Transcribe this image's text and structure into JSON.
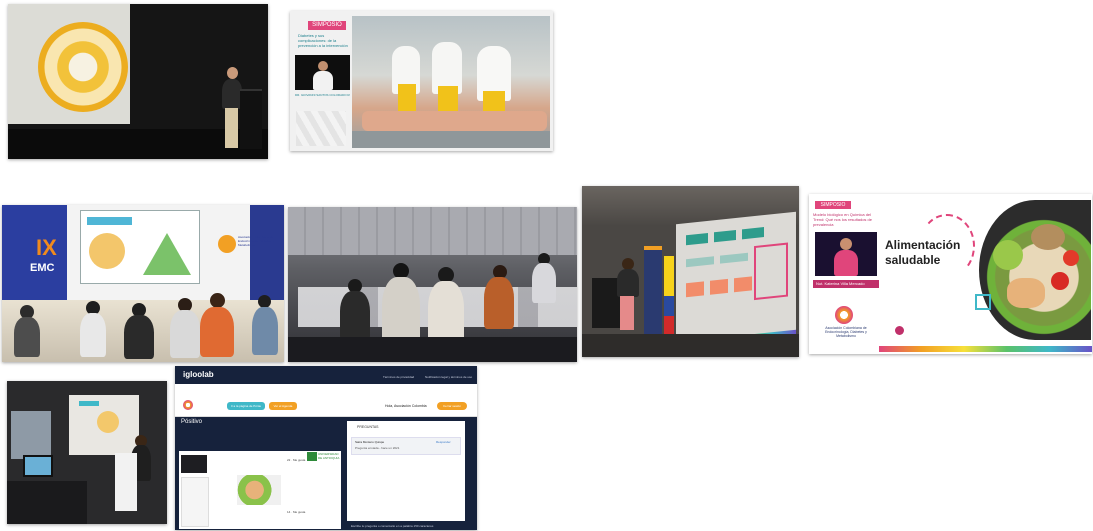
{
  "slide_symposium_1": {
    "badge": "SIMPOSIO",
    "title": "Diabetes y sus complicaciones: de la prevención a la intervención",
    "speaker": "DR. GIOVANNI SANTOS COLORADO ROJAS"
  },
  "slide_symposium_2": {
    "badge": "SIMPOSIO",
    "title": "Modelo biológico en Química del Trend: Qué nos los resultados de prevalencia",
    "heading": "Alimentación saludable",
    "speaker": "Nut. Katerina Villa Mercado",
    "org": "Asociación Colombiana de Endocrinología, Diabetes y Metabolismo"
  },
  "stage_banner": {
    "logo_letters": "IX",
    "sub": "EMC",
    "org": "Asociación Colombiana de Endocrinología, Diabetes y Metabolismo"
  },
  "webinar": {
    "brand": "igloolab",
    "top_links": [
      "Términos de privacidad",
      "Notificación legal y términos de uso"
    ],
    "nav_buttons": [
      "Ir a la página de Pónte",
      "Ver el Agenda"
    ],
    "user_greeting": "Hola, Asociación Colombia",
    "logout": "Cerrar sesión",
    "section": "Pósitivo",
    "university": "UNIVERSIDAD DE ANTIOQUIA",
    "questions_title": "PREGUNTAS",
    "question_author": "Saira Montero Quispe",
    "question_text": "Pregunta enviada - hace un 2021",
    "question_link": "Responder",
    "likes": [
      "22 · Me gusta",
      "14 · Me gusta"
    ],
    "footer_text": "Escribe tu pregunta o comentario en a palabra 150 caracteres"
  },
  "colors": {
    "accent_orange": "#f2a024",
    "pink": "#e0457b",
    "cyan": "#3fb8c8",
    "navy": "#1b2a4a"
  }
}
